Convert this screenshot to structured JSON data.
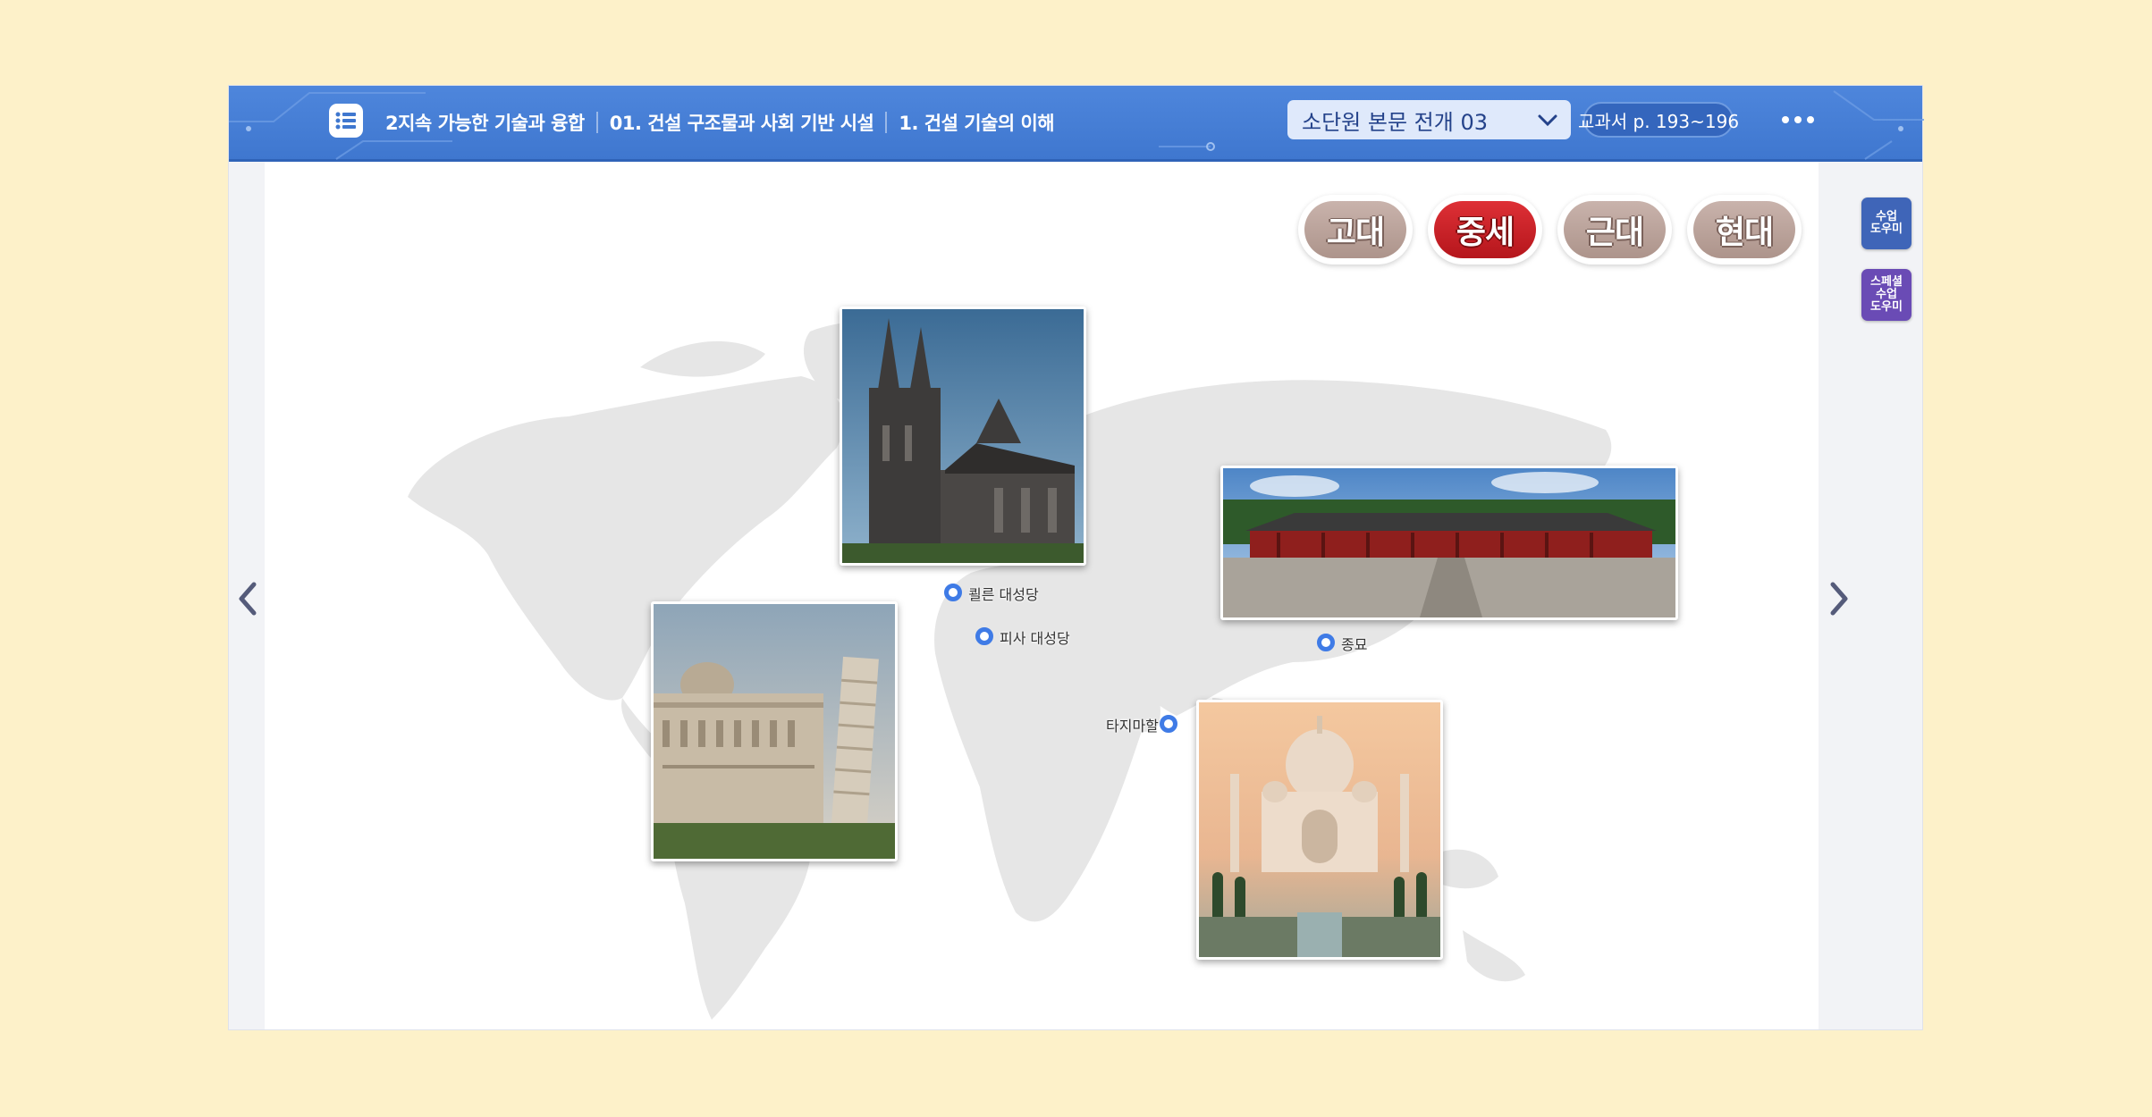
{
  "header": {
    "breadcrumb": [
      "2지속 가능한 기술과 융합",
      "01. 건설 구조물과 사회 기반 시설",
      "1. 건설 기술의 이해"
    ],
    "lesson_select": "소단원 본문 전개 03",
    "page_ref": "교과서 p. 193~196",
    "menu_icon": "list-icon",
    "more_icon": "more-dots-icon"
  },
  "era_tabs": [
    {
      "label": "고대",
      "active": false
    },
    {
      "label": "중세",
      "active": true
    },
    {
      "label": "근대",
      "active": false
    },
    {
      "label": "현대",
      "active": false
    }
  ],
  "landmarks": [
    {
      "label": "쾰른 대성당",
      "photo": "cologne-cathedral"
    },
    {
      "label": "피사 대성당",
      "photo": "pisa-cathedral"
    },
    {
      "label": "종묘",
      "photo": "jongmyo-shrine"
    },
    {
      "label": "타지마할",
      "photo": "taj-mahal"
    }
  ],
  "side_tools": [
    {
      "label": "수업\n도우미",
      "color": "#3f65b8"
    },
    {
      "label": "스페셜\n수업\n도우미",
      "color": "#6a4bb5"
    }
  ],
  "colors": {
    "background": "#fdf1c9",
    "header": "#4680d8",
    "active_tab": "#c91f25",
    "inactive_tab": "#bba29a",
    "pin": "#3f7be6",
    "map_land": "#e6e6e6"
  }
}
